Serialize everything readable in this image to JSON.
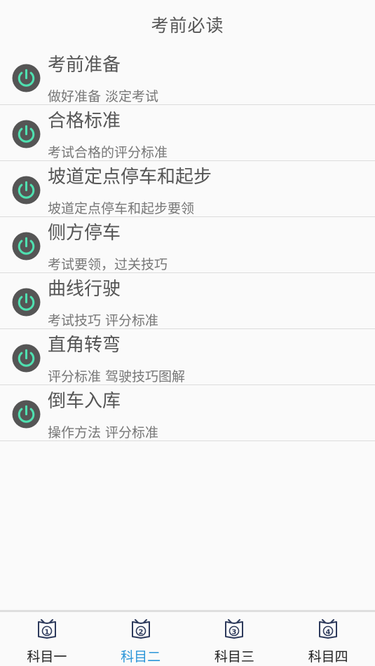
{
  "header": {
    "title": "考前必读"
  },
  "items": [
    {
      "title": "考前准备",
      "subtitle": "做好准备 淡定考试",
      "icon": "power-icon"
    },
    {
      "title": "合格标准",
      "subtitle": "考试合格的评分标准",
      "icon": "power-icon"
    },
    {
      "title": "坡道定点停车和起步",
      "subtitle": "坡道定点停车和起步要领",
      "icon": "power-icon"
    },
    {
      "title": "侧方停车",
      "subtitle": "考试要领，过关技巧",
      "icon": "power-icon"
    },
    {
      "title": "曲线行驶",
      "subtitle": "考试技巧 评分标准",
      "icon": "power-icon"
    },
    {
      "title": "直角转弯",
      "subtitle": "评分标准 驾驶技巧图解",
      "icon": "power-icon"
    },
    {
      "title": "倒车入库",
      "subtitle": "操作方法 评分标准",
      "icon": "power-icon"
    }
  ],
  "tabs": [
    {
      "label": "科目一",
      "number": "①",
      "active": false,
      "icon": "book-icon"
    },
    {
      "label": "科目二",
      "number": "②",
      "active": true,
      "icon": "book-icon"
    },
    {
      "label": "科目三",
      "number": "③",
      "active": false,
      "icon": "book-icon"
    },
    {
      "label": "科目四",
      "number": "④",
      "active": false,
      "icon": "book-icon"
    }
  ],
  "colors": {
    "accent": "#2a95d8",
    "icon_bg": "#555555",
    "icon_fg": "#4fe0b0"
  }
}
